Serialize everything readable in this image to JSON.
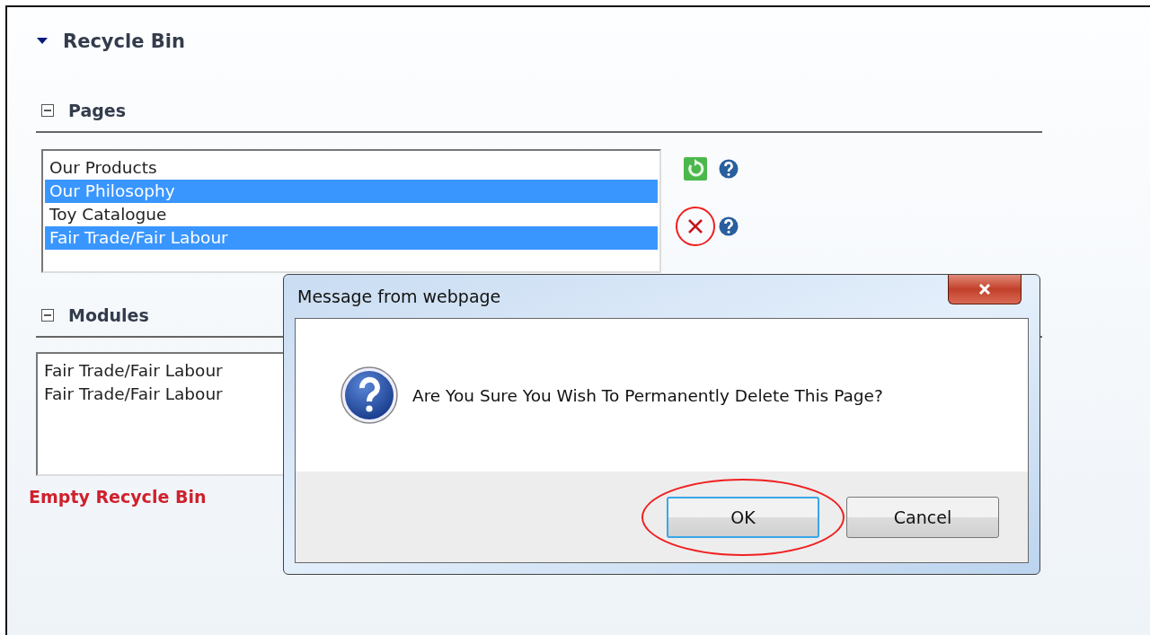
{
  "section": {
    "title": "Recycle Bin",
    "expanded": true
  },
  "pages": {
    "title": "Pages",
    "expanded": true,
    "items": [
      {
        "label": "Our Products",
        "selected": false
      },
      {
        "label": "Our Philosophy",
        "selected": true
      },
      {
        "label": "Toy Catalogue",
        "selected": false
      },
      {
        "label": "Fair Trade/Fair Labour",
        "selected": true
      }
    ],
    "actions": [
      {
        "kind": "restore",
        "highlighted": false
      },
      {
        "kind": "delete",
        "highlighted": true
      }
    ]
  },
  "modules": {
    "title": "Modules",
    "expanded": true,
    "items": [
      {
        "label": "Fair Trade/Fair Labour",
        "selected": false
      },
      {
        "label": "Fair Trade/Fair Labour",
        "selected": false
      }
    ]
  },
  "empty_link": "Empty Recycle Bin",
  "dialog": {
    "title": "Message from webpage",
    "message": "Are You Sure You Wish To Permanently Delete This Page?",
    "buttons": [
      {
        "label": "OK",
        "kind": "default",
        "highlighted": true
      },
      {
        "label": "Cancel",
        "kind": "normal",
        "highlighted": false
      }
    ]
  }
}
